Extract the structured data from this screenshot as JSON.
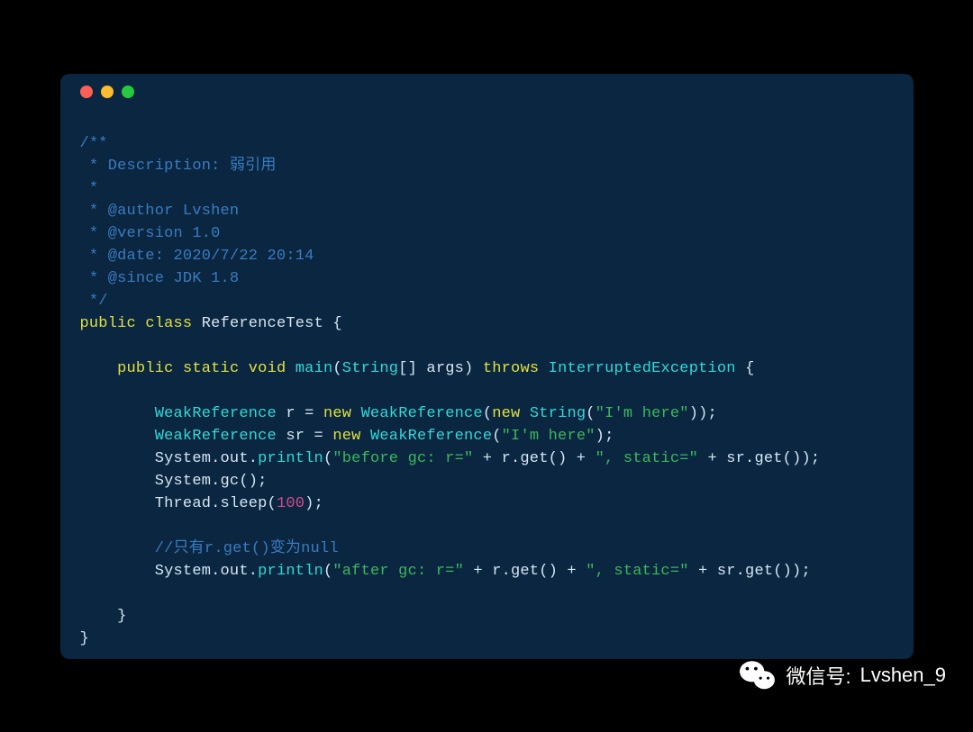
{
  "code": {
    "c1": "/**",
    "c2": " * Description: 弱引用",
    "c3": " *",
    "c4": " * @author Lvshen",
    "c5": " * @version 1.0",
    "c6": " * @date: 2020/7/22 20:14",
    "c7": " * @since JDK 1.8",
    "c8": " */",
    "kw_public": "public",
    "kw_class": "class",
    "kw_static": "static",
    "kw_void": "void",
    "kw_new": "new",
    "kw_throws": "throws",
    "className": "ReferenceTest",
    "mainMethod": "main",
    "stringType": "String",
    "weakRef": "WeakReference",
    "interruptedEx": "InterruptedException",
    "strImHere": "\"I'm here\"",
    "strBefore": "\"before gc: r=\"",
    "strAfter": "\"after gc: r=\"",
    "strStatic": "\", static=\"",
    "num100": "100",
    "commentNull": "//只有r.get()变为null",
    "txt_args": "[] args)",
    "txt_openBrace": " {",
    "txt_openBrace2": "{",
    "txt_closeBrace": "    }",
    "txt_closeBrace2": "}",
    "txt_r_eq": " r = ",
    "txt_sr_eq": " sr = ",
    "txt_openParen": "(",
    "txt_closeParenSemi": ");",
    "txt_closeParenDblSemi": "));",
    "txt_systemOut": "System.out.",
    "txt_println": "println",
    "txt_plus_rget_plus": " + r.get() + ",
    "txt_plus_srget": " + sr.get());",
    "txt_systemGc": "System.gc();",
    "txt_threadSleep": "Thread.sleep(",
    "txt_space": " ",
    "txt_comma": ", "
  },
  "watermark": {
    "label": "微信号:",
    "handle": "Lvshen_9"
  }
}
